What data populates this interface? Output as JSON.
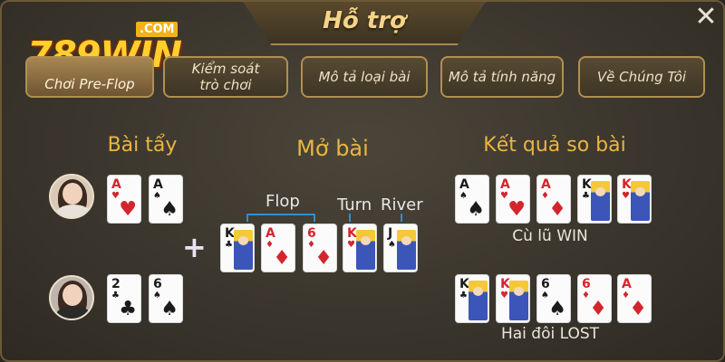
{
  "header": {
    "title": "Hỗ trợ"
  },
  "logo": {
    "badge": ".COM",
    "text": "789WIN"
  },
  "nav": [
    {
      "label": "Chơi Pre-Flop",
      "active": true
    },
    {
      "label": "Kiểm soát trò chơi",
      "active": false
    },
    {
      "label": "Mô tả loại bài",
      "active": false
    },
    {
      "label": "Mô tả tính năng",
      "active": false
    },
    {
      "label": "Về Chúng Tôi",
      "active": false
    }
  ],
  "sections": {
    "hole": "Bài tẩy",
    "board": "Mở bài",
    "result": "Kết quả so bài"
  },
  "board_labels": {
    "flop": "Flop",
    "turn": "Turn",
    "river": "River"
  },
  "players": {
    "p1": {
      "cards": [
        {
          "rank": "A",
          "suit": "♥",
          "color": "red"
        },
        {
          "rank": "A",
          "suit": "♠",
          "color": "black"
        }
      ]
    },
    "p2": {
      "cards": [
        {
          "rank": "2",
          "suit": "♣",
          "color": "black"
        },
        {
          "rank": "6",
          "suit": "♠",
          "color": "black"
        }
      ]
    }
  },
  "board_cards": [
    {
      "rank": "K",
      "suit": "♣",
      "color": "black",
      "face": true
    },
    {
      "rank": "A",
      "suit": "♦",
      "color": "red",
      "face": false
    },
    {
      "rank": "6",
      "suit": "♦",
      "color": "red",
      "face": false
    },
    {
      "rank": "K",
      "suit": "♥",
      "color": "red",
      "face": true
    },
    {
      "rank": "J",
      "suit": "♠",
      "color": "black",
      "face": true
    }
  ],
  "results": [
    {
      "text": "Cù lũ WIN",
      "cards": [
        {
          "rank": "A",
          "suit": "♠",
          "color": "black",
          "face": false
        },
        {
          "rank": "A",
          "suit": "♥",
          "color": "red",
          "face": false
        },
        {
          "rank": "A",
          "suit": "♦",
          "color": "red",
          "face": false
        },
        {
          "rank": "K",
          "suit": "♣",
          "color": "black",
          "face": true
        },
        {
          "rank": "K",
          "suit": "♥",
          "color": "red",
          "face": true
        }
      ]
    },
    {
      "text": "Hai đôi LOST",
      "cards": [
        {
          "rank": "K",
          "suit": "♣",
          "color": "black",
          "face": true
        },
        {
          "rank": "K",
          "suit": "♥",
          "color": "red",
          "face": true
        },
        {
          "rank": "6",
          "suit": "♠",
          "color": "black",
          "face": false
        },
        {
          "rank": "6",
          "suit": "♦",
          "color": "red",
          "face": false
        },
        {
          "rank": "A",
          "suit": "♦",
          "color": "red",
          "face": false
        }
      ]
    }
  ],
  "colors": {
    "gold": "#e9b544",
    "frame": "#b08f52",
    "bracket": "#2f8fd0"
  },
  "icons": {
    "close": "close-icon",
    "plus": "plus-icon"
  }
}
